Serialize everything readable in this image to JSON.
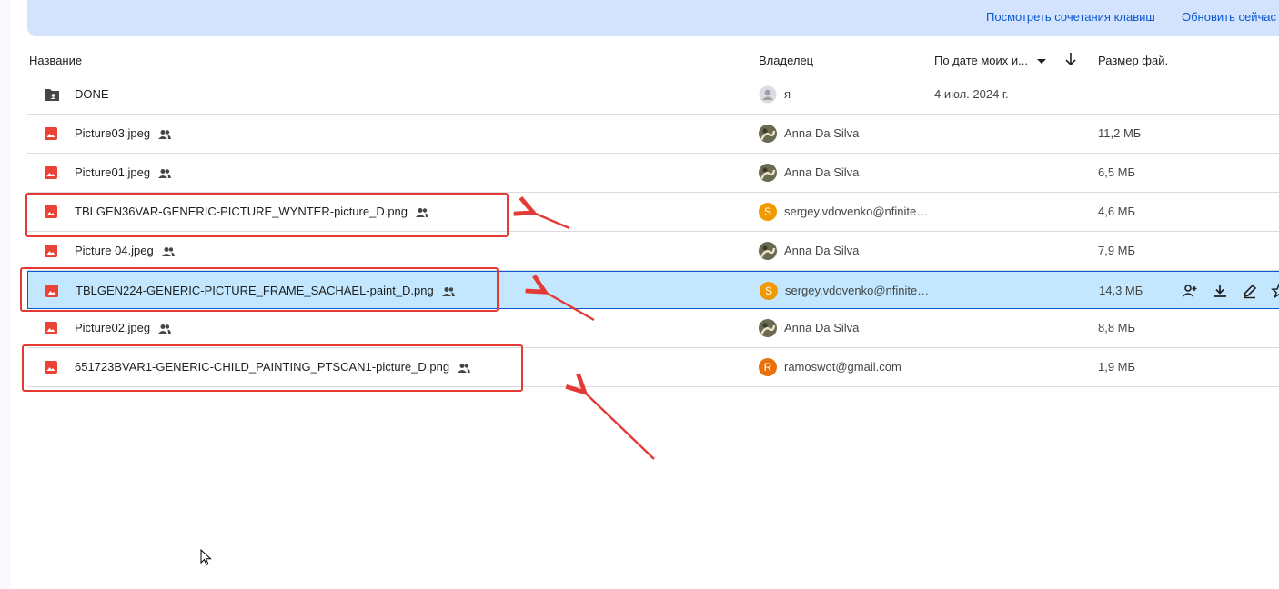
{
  "banner": {
    "shortcuts_label": "Посмотреть сочетания клавиш",
    "refresh_label": "Обновить сейчас"
  },
  "header": {
    "name": "Название",
    "owner": "Владелец",
    "date_sort": "По дате моих и...",
    "size": "Размер фай."
  },
  "colors": {
    "selected_bg": "#c2e7ff",
    "accent": "#0b57d0",
    "annotation_red": "#e53935",
    "image_icon": "#ea4335"
  },
  "rows": [
    {
      "name": "DONE",
      "type": "shared-folder-icon",
      "shared": false,
      "owner": "я",
      "avatar": "person-icon",
      "date": "4 июл. 2024 г.",
      "size": "—"
    },
    {
      "name": "Picture03.jpeg",
      "type": "image-file-icon",
      "shared": true,
      "owner": "Anna Da Silva",
      "avatar": "photo-avatar",
      "date": "",
      "size": "11,2 МБ"
    },
    {
      "name": "Picture01.jpeg",
      "type": "image-file-icon",
      "shared": true,
      "owner": "Anna Da Silva",
      "avatar": "photo-avatar",
      "date": "",
      "size": "6,5 МБ"
    },
    {
      "name": "TBLGEN36VAR-GENERIC-PICTURE_WYNTER-picture_D.png",
      "type": "image-file-icon",
      "shared": true,
      "owner": "sergey.vdovenko@nfinite…",
      "avatar_letter": "S",
      "date": "",
      "size": "4,6 МБ"
    },
    {
      "name": "Picture 04.jpeg",
      "type": "image-file-icon",
      "shared": true,
      "owner": "Anna Da Silva",
      "avatar": "photo-avatar",
      "date": "",
      "size": "7,9 МБ"
    },
    {
      "name": "TBLGEN224-GENERIC-PICTURE_FRAME_SACHAEL-paint_D.png",
      "type": "image-file-icon",
      "shared": true,
      "owner": "sergey.vdovenko@nfinite…",
      "avatar_letter": "S",
      "date": "",
      "size": "14,3 МБ",
      "selected": true
    },
    {
      "name": "Picture02.jpeg",
      "type": "image-file-icon",
      "shared": true,
      "owner": "Anna Da Silva",
      "avatar": "photo-avatar",
      "date": "",
      "size": "8,8 МБ"
    },
    {
      "name": "651723BVAR1-GENERIC-CHILD_PAINTING_PTSCAN1-picture_D.png",
      "type": "image-file-icon",
      "shared": true,
      "owner": "ramoswot@gmail.com",
      "avatar_letter": "R",
      "date": "",
      "size": "1,9 МБ"
    }
  ]
}
